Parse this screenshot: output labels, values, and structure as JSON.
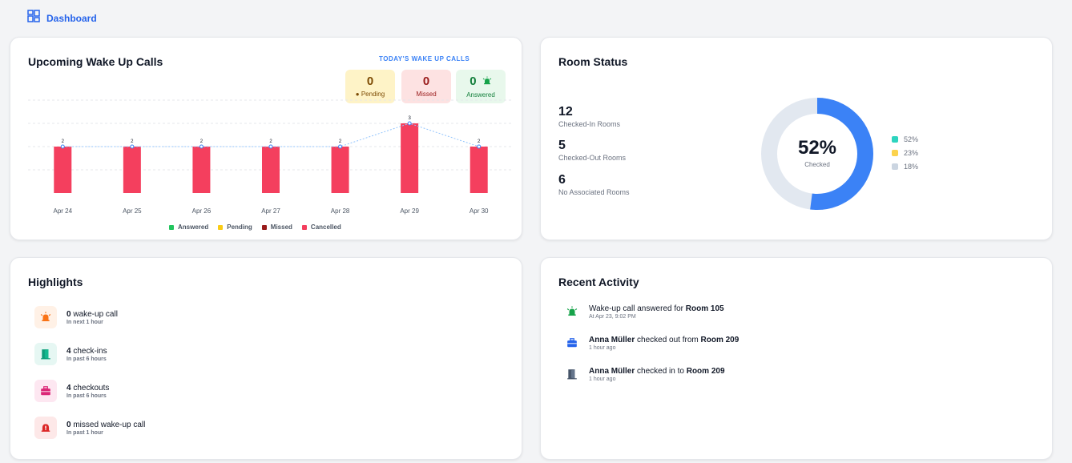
{
  "header": {
    "title": "Dashboard",
    "icon": "dashboard-grid-icon"
  },
  "wake_card": {
    "title": "Upcoming Wake Up Calls",
    "today_label": "TODAY'S WAKE UP CALLS",
    "pending": {
      "value": "0",
      "label": "● Pending"
    },
    "missed": {
      "value": "0",
      "label": "Missed"
    },
    "answered": {
      "value": "0",
      "label": "Answered",
      "icon": "alarm-ringing-icon"
    },
    "legend": [
      "Answered",
      "Pending",
      "Missed",
      "Cancelled"
    ]
  },
  "chart_data": {
    "type": "bar",
    "categories": [
      "Apr 24",
      "Apr 25",
      "Apr 26",
      "Apr 27",
      "Apr 28",
      "Apr 29",
      "Apr 30"
    ],
    "series": [
      {
        "name": "Cancelled",
        "values": [
          2,
          2,
          2,
          2,
          2,
          3,
          2
        ]
      }
    ],
    "line_overlay": [
      2,
      2,
      2,
      2,
      2,
      3,
      2
    ],
    "data_labels": [
      "2",
      "2",
      "2",
      "2",
      "2",
      "3",
      "2"
    ],
    "legend": [
      {
        "name": "Answered",
        "color": "#22c55e"
      },
      {
        "name": "Pending",
        "color": "#facc15"
      },
      {
        "name": "Missed",
        "color": "#991b1b"
      },
      {
        "name": "Cancelled",
        "color": "#f43f5e"
      }
    ],
    "ylim": [
      0,
      4
    ],
    "grid": true,
    "legend_position": "bottom-center"
  },
  "room_card": {
    "title": "Room Status",
    "items": [
      {
        "value": "12",
        "label": "Checked-In Rooms"
      },
      {
        "value": "5",
        "label": "Checked-Out Rooms"
      },
      {
        "value": "6",
        "label": "No Associated Rooms"
      }
    ],
    "donut": {
      "percent_text": "52%",
      "label": "Checked",
      "fraction": 0.52,
      "color": "#3b82f6",
      "track": "#e2e8f0"
    },
    "legend": [
      {
        "label": "52%",
        "color": "#2dd4bf"
      },
      {
        "label": "23%",
        "color": "#fcd34d"
      },
      {
        "label": "18%",
        "color": "#cbd5e1"
      }
    ]
  },
  "highlights": {
    "title": "Highlights",
    "items": [
      {
        "count": "0",
        "text": " wake-up call",
        "sub": "In next 1 hour",
        "icon": "alarm-ringing-icon"
      },
      {
        "count": "4",
        "text": " check-ins",
        "sub": "In past 6 hours",
        "icon": "door-open-icon"
      },
      {
        "count": "4",
        "text": " checkouts",
        "sub": "In past 6 hours",
        "icon": "briefcase-icon"
      },
      {
        "count": "0",
        "text": " missed wake-up call",
        "sub": "In past 1 hour",
        "icon": "bell-alert-icon"
      }
    ]
  },
  "recent": {
    "title": "Recent Activity",
    "items": [
      {
        "pre": "",
        "who": "",
        "mid": "Wake-up call answered for ",
        "room": "Room 105",
        "sub": "At Apr 23, 9:02 PM",
        "icon": "alarm-ringing-icon"
      },
      {
        "pre": "",
        "who": "Anna Müller",
        "mid": " checked out from ",
        "room": "Room 209",
        "sub": "1 hour ago",
        "icon": "briefcase-icon"
      },
      {
        "pre": "",
        "who": "Anna Müller",
        "mid": " checked in to ",
        "room": "Room 209",
        "sub": "1 hour ago",
        "icon": "door-open-icon"
      }
    ]
  }
}
